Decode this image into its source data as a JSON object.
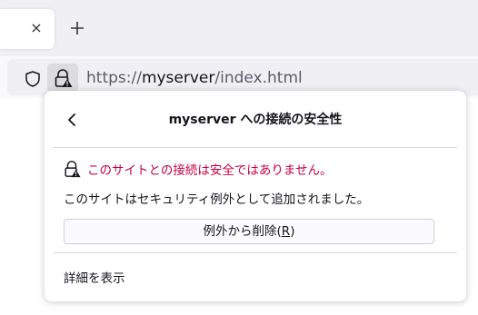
{
  "tab": {
    "close_glyph": "×",
    "new_tab_glyph": "+"
  },
  "urlbar": {
    "scheme": "https://",
    "host": "myserver",
    "path": "/index.html"
  },
  "panel": {
    "title": "myserver への接続の安全性",
    "warning": "このサイトとの接続は安全ではありません。",
    "info": "このサイトはセキュリティ例外として追加されました。",
    "remove_exception_label": "例外から削除(",
    "remove_exception_accesskey": "R",
    "remove_exception_close": ")",
    "more_info": "詳細を表示"
  },
  "colors": {
    "warning": "#c50042",
    "text": "#15141a",
    "url_muted": "#5b5b66"
  },
  "icons": {
    "shield": "shield-icon",
    "lock": "lock-warning-icon",
    "back": "chevron-left-icon",
    "tab_close": "close-icon",
    "new_tab": "plus-icon"
  }
}
